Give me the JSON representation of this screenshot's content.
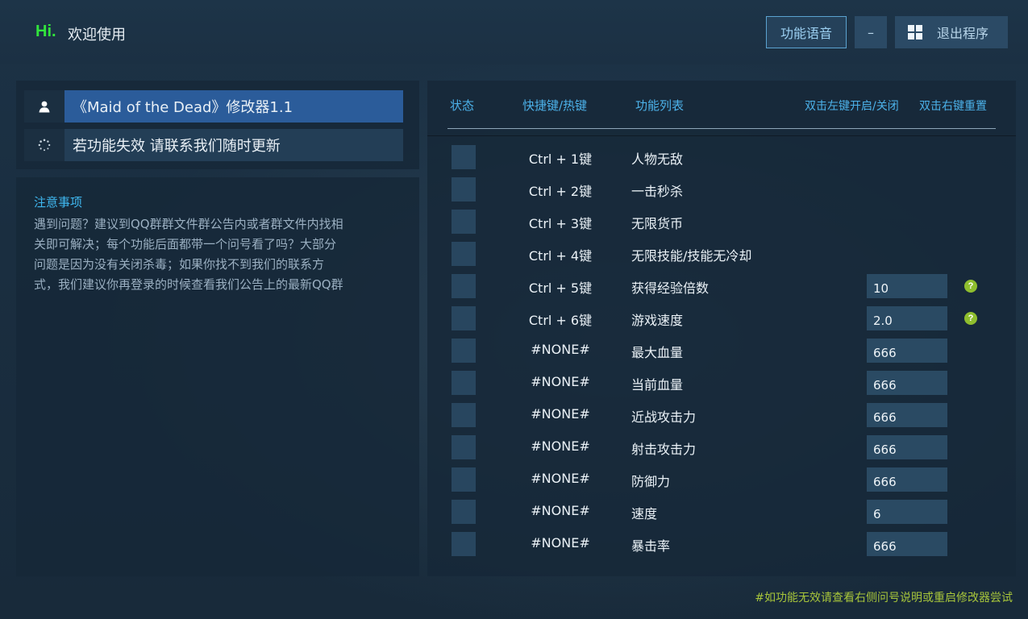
{
  "header": {
    "hi": "Hi.",
    "welcome": "欢迎使用",
    "voice_button": "功能语音",
    "minimize_button": "–",
    "exit_button": "退出程序"
  },
  "sidebar": {
    "items": [
      {
        "icon": "user-icon",
        "label": "《Maid of the Dead》修改器1.1"
      },
      {
        "icon": "loading-icon",
        "label": "若功能失效 请联系我们随时更新"
      }
    ]
  },
  "notice": {
    "title": "注意事项",
    "lines": [
      "遇到问题？建议到QQ群群文件群公告内或者群文件内找相",
      "关即可解决；每个功能后面都带一个问号看了吗？大部分",
      "问题是因为没有关闭杀毒；如果你找不到我们的联系方",
      "式，我们建议你再登录的时候查看我们公告上的最新QQ群"
    ]
  },
  "table": {
    "headers": {
      "status": "状态",
      "hotkey": "快捷键/热键",
      "features": "功能列表",
      "left_hint": "双击左键开启/关闭",
      "right_hint": "双击右键重置"
    },
    "rows": [
      {
        "hotkey": "Ctrl + 1键",
        "name": "人物无敌"
      },
      {
        "hotkey": "Ctrl + 2键",
        "name": "一击秒杀"
      },
      {
        "hotkey": "Ctrl + 3键",
        "name": "无限货币"
      },
      {
        "hotkey": "Ctrl + 4键",
        "name": "无限技能/技能无冷却"
      },
      {
        "hotkey": "Ctrl + 5键",
        "name": "获得经验倍数",
        "value": "10",
        "help": "?"
      },
      {
        "hotkey": "Ctrl + 6键",
        "name": "游戏速度",
        "value": "2.0",
        "help": "?"
      },
      {
        "hotkey": "#NONE#",
        "name": "最大血量",
        "value": "666"
      },
      {
        "hotkey": "#NONE#",
        "name": "当前血量",
        "value": "666"
      },
      {
        "hotkey": "#NONE#",
        "name": "近战攻击力",
        "value": "666"
      },
      {
        "hotkey": "#NONE#",
        "name": "射击攻击力",
        "value": "666"
      },
      {
        "hotkey": "#NONE#",
        "name": "防御力",
        "value": "666"
      },
      {
        "hotkey": "#NONE#",
        "name": "速度",
        "value": "6"
      },
      {
        "hotkey": "#NONE#",
        "name": "暴击率",
        "value": "666"
      }
    ]
  },
  "footer": "#如功能无效请查看右侧问号说明或重启修改器尝试",
  "colors": {
    "accent_green": "#31e53c",
    "accent_blue": "#4cb2ea",
    "selected_item": "#2b5c9a",
    "footer_text": "#a7c53a"
  }
}
